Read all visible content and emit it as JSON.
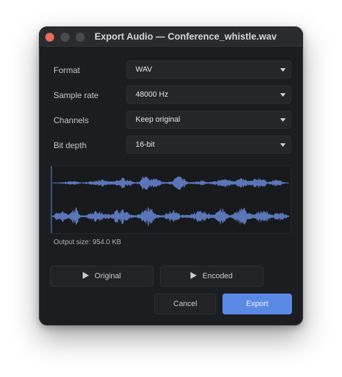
{
  "window": {
    "title": "Export Audio — Conference_whistle.wav"
  },
  "form": {
    "rows": [
      {
        "label": "Format",
        "value": "WAV"
      },
      {
        "label": "Sample rate",
        "value": "48000 Hz"
      },
      {
        "label": "Channels",
        "value": "Keep original"
      },
      {
        "label": "Bit depth",
        "value": "16-bit"
      }
    ]
  },
  "output_size": "Output size: 954.0 KB",
  "buttons": {
    "original": "Original",
    "encoded": "Encoded",
    "cancel": "Cancel",
    "export": "Export"
  },
  "colors": {
    "accent": "#5b8ae6",
    "waveform": "#5a76b8",
    "close": "#ed6a5e"
  },
  "icons": {
    "play": "play-icon",
    "dropdown": "chevron-down-icon"
  }
}
